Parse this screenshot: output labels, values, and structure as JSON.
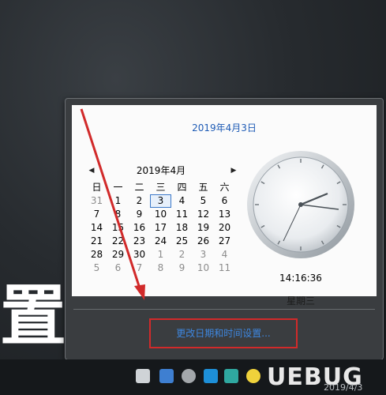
{
  "flyout": {
    "date_header": "2019年4月3日",
    "month_label": "2019年4月",
    "prev_arrow": "◀",
    "next_arrow": "▶",
    "weekdays": [
      "日",
      "一",
      "二",
      "三",
      "四",
      "五",
      "六"
    ],
    "weeks": [
      [
        "31",
        "1",
        "2",
        "3",
        "4",
        "5",
        "6"
      ],
      [
        "7",
        "8",
        "9",
        "10",
        "11",
        "12",
        "13"
      ],
      [
        "14",
        "15",
        "16",
        "17",
        "18",
        "19",
        "20"
      ],
      [
        "21",
        "22",
        "23",
        "24",
        "25",
        "26",
        "27"
      ],
      [
        "28",
        "29",
        "30",
        "1",
        "2",
        "3",
        "4"
      ],
      [
        "5",
        "6",
        "7",
        "8",
        "9",
        "10",
        "11"
      ]
    ],
    "today": "3",
    "clock_time": "14:16:36",
    "weekday_label": "星期三",
    "change_link": "更改日期和时间设置..."
  },
  "background": {
    "big_char": "置"
  },
  "watermark": {
    "text": "UEBUG",
    "sub": "2019/4/3"
  },
  "colors": {
    "accent": "#1e5bb5",
    "link": "#3e87e0",
    "highlight_box": "#d12a2a",
    "arrow": "#d12a2a"
  }
}
